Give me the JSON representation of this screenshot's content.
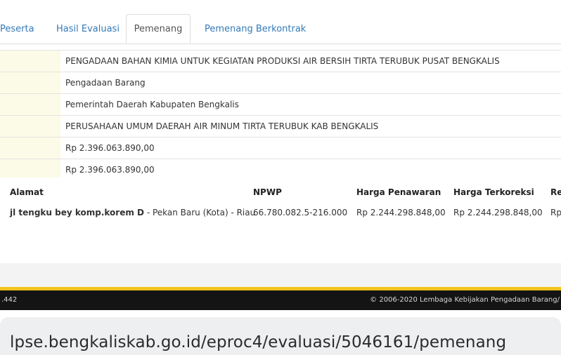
{
  "tabs": [
    {
      "label": "Peserta"
    },
    {
      "label": "Hasil Evaluasi"
    },
    {
      "label": "Pemenang"
    },
    {
      "label": "Pemenang Berkontrak"
    }
  ],
  "info_rows": [
    "PENGADAAN BAHAN KIMIA UNTUK KEGIATAN PRODUKSI AIR BERSIH TIRTA TERUBUK PUSAT BENGKALIS",
    "Pengadaan Barang",
    "Pemerintah Daerah Kabupaten Bengkalis",
    "PERUSAHAAN UMUM DAERAH AIR MINUM TIRTA TERUBUK KAB BENGKALIS",
    "Rp 2.396.063.890,00",
    "Rp 2.396.063.890,00"
  ],
  "winner_table": {
    "headers": [
      "Alamat",
      "NPWP",
      "Harga Penawaran",
      "Harga Terkoreksi",
      "Re"
    ],
    "row": {
      "address_bold": "jl tengku bey komp.korem D",
      "address_rest": " - Pekan Baru (Kota) - Riau",
      "npwp": "66.780.082.5-216.000",
      "harga_penawaran": "Rp 2.244.298.848,00",
      "harga_terkoreksi": "Rp 2.244.298.848,00",
      "extra": "Rp"
    }
  },
  "footer": {
    "version": ".442",
    "copyright": "© 2006-2020 Lembaga Kebijakan Pengadaan Barang/"
  },
  "address_bar": {
    "url": "lpse.bengkaliskab.go.id/eproc4/evaluasi/5046161/pemenang"
  }
}
